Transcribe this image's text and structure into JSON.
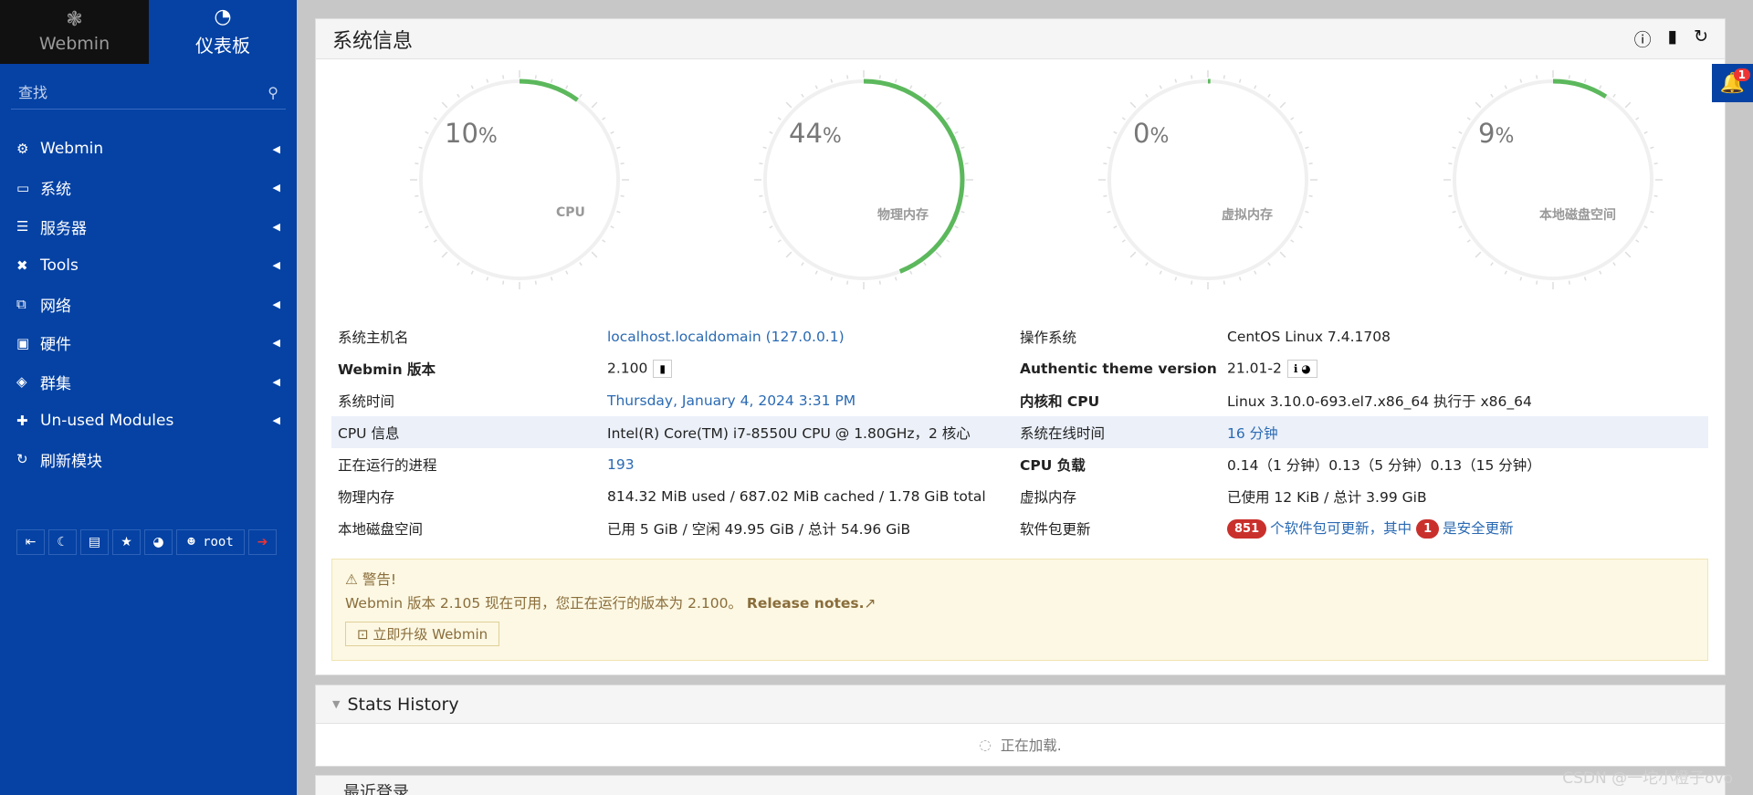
{
  "sidebar": {
    "brand_label": "Webmin",
    "dashboard_label": "仪表板",
    "search_placeholder": "查找",
    "items": [
      {
        "label": "Webmin",
        "icon": "gear-icon"
      },
      {
        "label": "系统",
        "icon": "laptop-icon"
      },
      {
        "label": "服务器",
        "icon": "server-icon"
      },
      {
        "label": "Tools",
        "icon": "tools-icon"
      },
      {
        "label": "网络",
        "icon": "network-icon"
      },
      {
        "label": "硬件",
        "icon": "hardware-icon"
      },
      {
        "label": "群集",
        "icon": "layers-icon"
      },
      {
        "label": "Un-used Modules",
        "icon": "puzzle-icon"
      },
      {
        "label": "刷新模块",
        "icon": "refresh-icon"
      }
    ],
    "user": "root"
  },
  "panel": {
    "title": "系统信息"
  },
  "gauges": [
    {
      "value": 10,
      "unit": "%",
      "label": "CPU"
    },
    {
      "value": 44,
      "unit": "%",
      "label": "物理内存"
    },
    {
      "value": 0,
      "unit": "%",
      "label": "虚拟内存"
    },
    {
      "value": 9,
      "unit": "%",
      "label": "本地磁盘空间"
    }
  ],
  "info": {
    "hostname_label": "系统主机名",
    "hostname_value": "localhost.localdomain (127.0.0.1)",
    "os_label": "操作系统",
    "os_value": "CentOS Linux 7.4.1708",
    "webmin_version_label": "Webmin 版本",
    "webmin_version_value": "2.100",
    "theme_version_label": "Authentic theme version",
    "theme_version_value": "21.01-2",
    "time_label": "系统时间",
    "time_value": "Thursday, January 4, 2024 3:31 PM",
    "kernel_label": "内核和 CPU",
    "kernel_value": "Linux 3.10.0-693.el7.x86_64 执行于 x86_64",
    "cpu_info_label": "CPU 信息",
    "cpu_info_value": "Intel(R) Core(TM) i7-8550U CPU @ 1.80GHz，2 核心",
    "uptime_label": "系统在线时间",
    "uptime_value": "16 分钟",
    "processes_label": "正在运行的进程",
    "processes_value": "193",
    "cpu_load_label": "CPU 负载",
    "cpu_load_value": "0.14（1 分钟）0.13（5 分钟）0.13（15 分钟）",
    "real_mem_label": "物理内存",
    "real_mem_value": "814.32 MiB used / 687.02 MiB cached / 1.78 GiB total",
    "virt_mem_label": "虚拟内存",
    "virt_mem_value": "已使用 12 KiB / 总计 3.99 GiB",
    "disk_label": "本地磁盘空间",
    "disk_value": "已用 5 GiB / 空闲 49.95 GiB / 总计 54.96 GiB",
    "updates_label": "软件包更新",
    "updates_count": "851",
    "updates_text": "个软件包可更新，其中",
    "security_count": "1",
    "security_text": "是安全更新"
  },
  "alert": {
    "title": "警告!",
    "message": "Webmin 版本 2.105 现在可用，您正在运行的版本为 2.100。",
    "release_notes": "Release notes.",
    "upgrade_button": "立即升级 Webmin"
  },
  "stats": {
    "title": "Stats History",
    "loading": "正在加载."
  },
  "recent": {
    "title": "最近登录"
  },
  "notifications": {
    "count": "1"
  },
  "watermark": "CSDN @一坨小橙子ovo",
  "colors": {
    "sidebar": "#0542a4",
    "gauge_fill": "#5cb85c",
    "badge": "#c9302c"
  }
}
